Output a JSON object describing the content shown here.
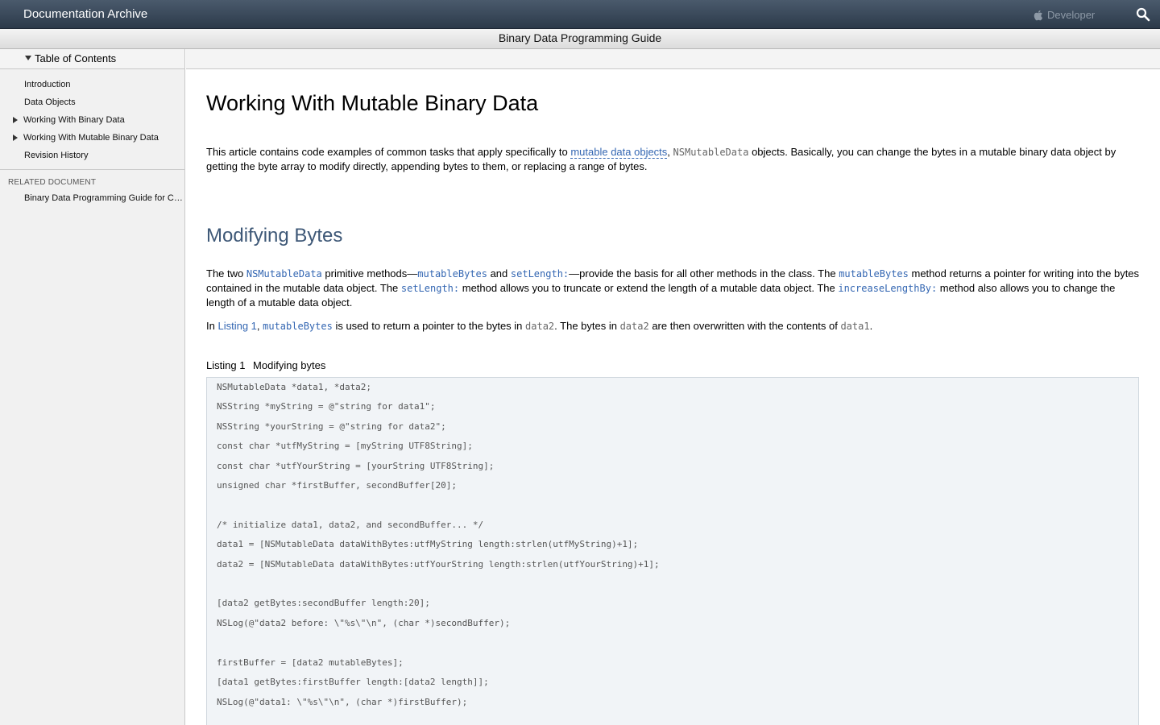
{
  "topbar": {
    "title": "Documentation Archive",
    "developer_label": "Developer",
    "apple_icon": "apple-logo",
    "search_icon": "search-icon"
  },
  "docbar": {
    "title": "Binary Data Programming Guide"
  },
  "sidebar": {
    "toc_header": "Table of Contents",
    "items": [
      {
        "label": "Introduction",
        "expandable": false
      },
      {
        "label": "Data Objects",
        "expandable": false
      },
      {
        "label": "Working With Binary Data",
        "expandable": true
      },
      {
        "label": "Working With Mutable Binary Data",
        "expandable": true
      },
      {
        "label": "Revision History",
        "expandable": false
      }
    ],
    "related_title": "RELATED DOCUMENT",
    "related_item": "Binary Data Programming Guide for Core Foundation"
  },
  "content": {
    "title": "Working With Mutable Binary Data",
    "intro": {
      "t1": "This article contains code examples of common tasks that apply specifically to ",
      "link1": "mutable data objects",
      "t2": ", ",
      "code1": "NSMutableData",
      "t3": " objects. Basically, you can change the bytes in a mutable binary data object by getting the byte array to modify directly, appending bytes to them, or replacing a range of bytes."
    },
    "section_title": "Modifying Bytes",
    "p1": {
      "t1": "The two ",
      "c1": "NSMutableData",
      "t2": " primitive methods—",
      "c2": "mutableBytes",
      "t3": " and ",
      "c3": "setLength:",
      "t4": "—provide the basis for all other methods in the class. The ",
      "c4": "mutableBytes",
      "t5": " method returns a pointer for writing into the bytes contained in the mutable data object. The ",
      "c5": "setLength:",
      "t6": " method allows you to truncate or extend the length of a mutable data object. The ",
      "c6": "increaseLengthBy:",
      "t7": " method also allows you to change the length of a mutable data object."
    },
    "p2": {
      "t1": "In ",
      "link": "Listing 1",
      "t2": ", ",
      "c1": "mutableBytes",
      "t3": " is used to return a pointer to the bytes in ",
      "c2": "data2",
      "t4": ". The bytes in ",
      "c3": "data2",
      "t5": " are then overwritten with the contents of ",
      "c4": "data1",
      "t6": "."
    },
    "listing_number": "Listing 1",
    "listing_title": "Modifying bytes",
    "code": "NSMutableData *data1, *data2;\nNSString *myString = @\"string for data1\";\nNSString *yourString = @\"string for data2\";\nconst char *utfMyString = [myString UTF8String];\nconst char *utfYourString = [yourString UTF8String];\nunsigned char *firstBuffer, secondBuffer[20];\n\n/* initialize data1, data2, and secondBuffer... */\ndata1 = [NSMutableData dataWithBytes:utfMyString length:strlen(utfMyString)+1];\ndata2 = [NSMutableData dataWithBytes:utfYourString length:strlen(utfYourString)+1];\n\n[data2 getBytes:secondBuffer length:20];\nNSLog(@\"data2 before: \\\"%s\\\"\\n\", (char *)secondBuffer);\n\nfirstBuffer = [data2 mutableBytes];\n[data1 getBytes:firstBuffer length:[data2 length]];\nNSLog(@\"data1: \\\"%s\\\"\\n\", (char *)firstBuffer);"
  }
}
